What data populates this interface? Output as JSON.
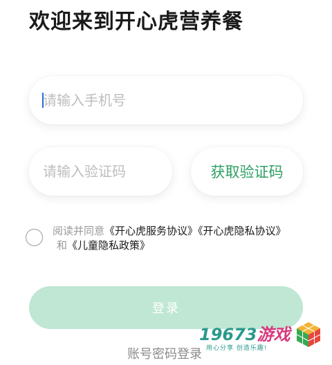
{
  "header": {
    "title": "欢迎来到开心虎营养餐"
  },
  "form": {
    "phone_placeholder": "请输入手机号",
    "code_placeholder": "请输入验证码",
    "get_code_label": "获取验证码"
  },
  "agreement": {
    "prefix": "阅读并同意",
    "service_agreement": "《开心虎服务协议》",
    "privacy_agreement": "《开心虎隐私协议》",
    "and": "和",
    "children_policy": "《儿童隐私政策》"
  },
  "actions": {
    "login_label": "登录",
    "password_login_label": "账号密码登录"
  },
  "watermark": {
    "number": "19673",
    "game_text": "游戏",
    "slogan": "用心分享 创造乐趣!"
  },
  "colors": {
    "accent": "#2e9e63",
    "login_button_disabled": "#bfe7d3",
    "caret": "#2a6ad8"
  },
  "icons": {
    "watermark_logo": "cube-logo-icon"
  }
}
